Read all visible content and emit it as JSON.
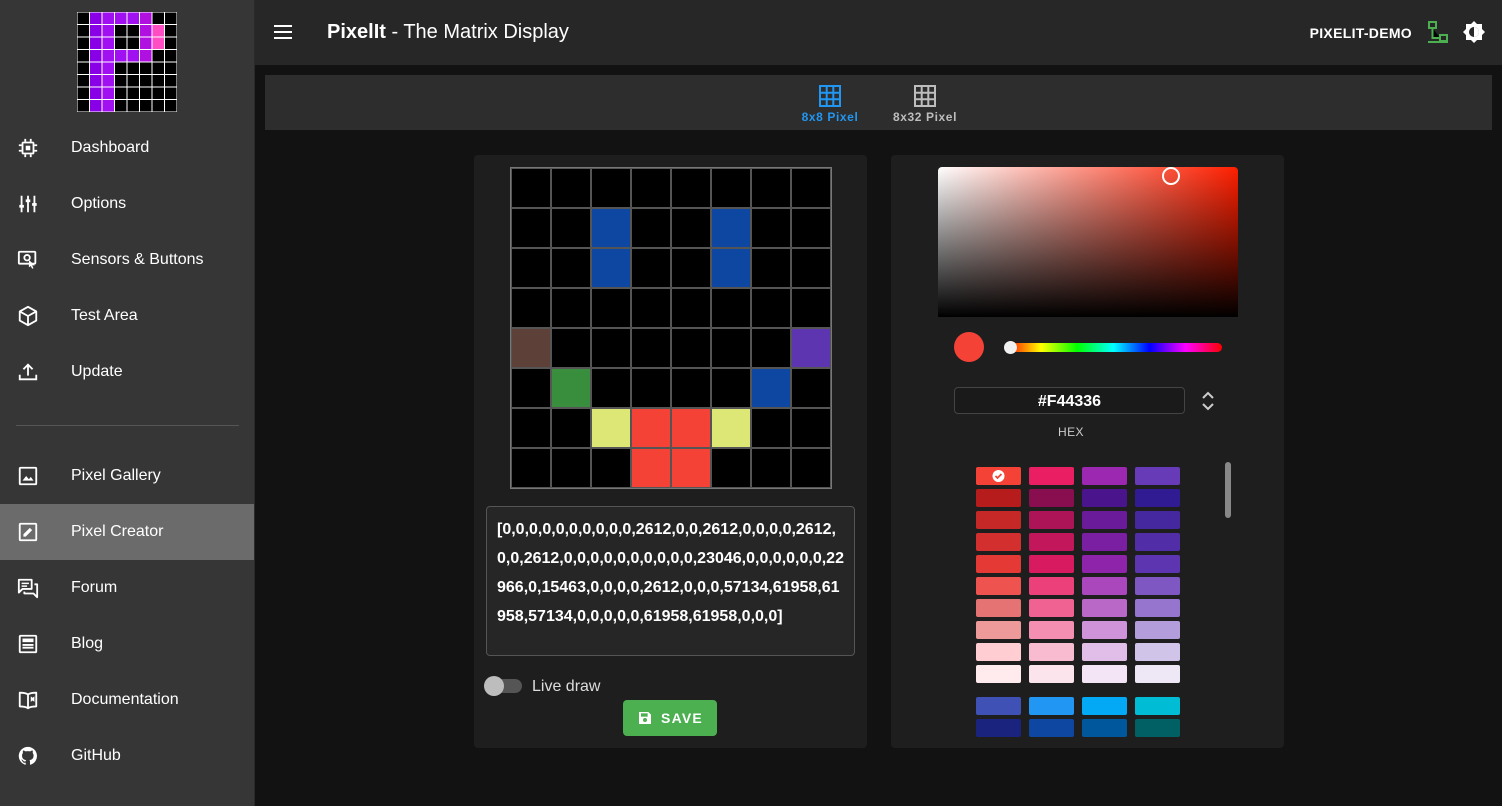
{
  "app": {
    "title_bold": "PixelIt",
    "title_rest": " - The Matrix Display",
    "hostname": "PIXELIT-DEMO"
  },
  "colors": {
    "accent": "#2196F3",
    "success": "#4CAF50",
    "sidebar_bg": "#363636",
    "topbar_bg": "#272727",
    "active_nav_bg": "#6b6b6b"
  },
  "logo": {
    "pixels": [
      [
        0,
        1,
        2,
        2,
        2,
        3,
        0,
        0
      ],
      [
        0,
        1,
        2,
        0,
        0,
        3,
        4,
        0
      ],
      [
        0,
        1,
        2,
        0,
        0,
        3,
        4,
        0
      ],
      [
        0,
        1,
        2,
        2,
        2,
        3,
        0,
        0
      ],
      [
        0,
        1,
        2,
        0,
        0,
        0,
        0,
        0
      ],
      [
        0,
        1,
        2,
        0,
        0,
        0,
        0,
        0
      ],
      [
        0,
        1,
        2,
        0,
        0,
        0,
        0,
        0
      ],
      [
        0,
        1,
        2,
        0,
        0,
        0,
        0,
        0
      ]
    ],
    "palette": [
      "#000000",
      "#8a00e6",
      "#a010f0",
      "#b010e0",
      "#ff4dc4"
    ]
  },
  "sidebar": {
    "items": [
      {
        "label": "Dashboard",
        "icon": "chip-icon"
      },
      {
        "label": "Options",
        "icon": "tune-icon"
      },
      {
        "label": "Sensors & Buttons",
        "icon": "touch-icon"
      },
      {
        "label": "Test Area",
        "icon": "cube-icon"
      },
      {
        "label": "Update",
        "icon": "upload-icon"
      },
      {
        "label": "Pixel Gallery",
        "icon": "image-icon"
      },
      {
        "label": "Pixel Creator",
        "icon": "edit-box-icon",
        "active": true
      },
      {
        "label": "Forum",
        "icon": "forum-icon"
      },
      {
        "label": "Blog",
        "icon": "newspaper-icon"
      },
      {
        "label": "Documentation",
        "icon": "book-icon"
      },
      {
        "label": "GitHub",
        "icon": "github-icon"
      }
    ]
  },
  "tabs": [
    {
      "label": "8x8 Pixel",
      "icon": "grid-icon",
      "active": true
    },
    {
      "label": "8x32 Pixel",
      "icon": "grid-icon",
      "active": false
    }
  ],
  "editor": {
    "grid": [
      [
        0,
        0,
        0,
        0,
        0,
        0,
        0,
        0
      ],
      [
        0,
        0,
        1,
        0,
        0,
        1,
        0,
        0
      ],
      [
        0,
        0,
        1,
        0,
        0,
        1,
        0,
        0
      ],
      [
        0,
        0,
        0,
        0,
        0,
        0,
        0,
        0
      ],
      [
        2,
        0,
        0,
        0,
        0,
        0,
        0,
        3
      ],
      [
        0,
        4,
        0,
        0,
        0,
        0,
        1,
        0
      ],
      [
        0,
        0,
        5,
        6,
        6,
        5,
        0,
        0
      ],
      [
        0,
        0,
        0,
        6,
        6,
        0,
        0,
        0
      ]
    ],
    "grid_colors": [
      "#000000",
      "#0d47a1",
      "#5d4037",
      "#5e35b1",
      "#388e3c",
      "#dce775",
      "#f44336"
    ],
    "code_text": "[0,0,0,0,0,0,0,0,0,0,2612,0,0,2612,0,0,0,0,2612,0,0,2612,0,0,0,0,0,0,0,0,0,0,23046,0,0,0,0,0,0,22966,0,15463,0,0,0,0,2612,0,0,0,57134,61958,61958,57134,0,0,0,0,0,61958,61958,0,0,0]",
    "live_draw_label": "Live draw",
    "live_draw_on": false,
    "save_label": "SAVE"
  },
  "color_picker": {
    "hex_value": "#F44336",
    "mode_label": "HEX",
    "current_color": "#F44336",
    "hue_position": 0,
    "palette_columns": [
      [
        "#f44336",
        "#b71c1c",
        "#c62828",
        "#d32f2f",
        "#e53935",
        "#ef5350",
        "#e57373",
        "#ef9a9a",
        "#ffcdd2",
        "#ffebee",
        "#3f51b5",
        "#1a237e"
      ],
      [
        "#e91e63",
        "#880e4f",
        "#ad1457",
        "#c2185b",
        "#d81b60",
        "#ec407a",
        "#f06292",
        "#f48fb1",
        "#f8bbd0",
        "#fce4ec",
        "#2196f3",
        "#0d47a1"
      ],
      [
        "#9c27b0",
        "#4a148c",
        "#6a1b9a",
        "#7b1fa2",
        "#8e24aa",
        "#ab47bc",
        "#ba68c8",
        "#ce93d8",
        "#e1bee7",
        "#f3e5f5",
        "#03a9f4",
        "#01579b"
      ],
      [
        "#673ab7",
        "#311b92",
        "#4527a0",
        "#512da8",
        "#5e35b1",
        "#7e57c2",
        "#9575cd",
        "#b39ddb",
        "#d1c4e9",
        "#ede7f6",
        "#00bcd4",
        "#006064"
      ]
    ],
    "selected_swatch": "#f44336"
  }
}
